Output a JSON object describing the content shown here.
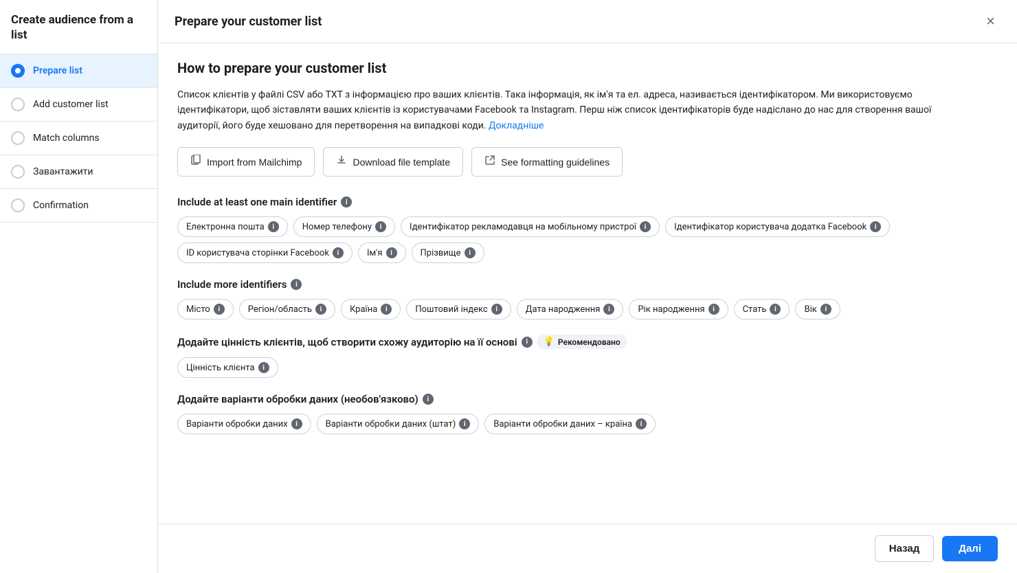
{
  "sidebar": {
    "title": "Create audience from a list",
    "items": [
      {
        "id": "prepare-list",
        "label": "Prepare list",
        "active": true
      },
      {
        "id": "add-customer-list",
        "label": "Add customer list",
        "active": false
      },
      {
        "id": "match-columns",
        "label": "Match columns",
        "active": false
      },
      {
        "id": "upload",
        "label": "Завантажити",
        "active": false
      },
      {
        "id": "confirmation",
        "label": "Confirmation",
        "active": false
      }
    ]
  },
  "header": {
    "title": "Prepare your customer list",
    "close_label": "×"
  },
  "main": {
    "section_title": "How to prepare your customer list",
    "description": "Список клієнтів у файлі CSV або TXT з інформацією про ваших клієнтів. Така інформація, як ім'я та ел. адреса, називається ідентифікатором. Ми використовуємо ідентифікатори, щоб зіставляти ваших клієнтів із користувачами Facebook та Instagram. Перш ніж список ідентифікаторів буде надіслано до нас для створення вашої аудиторії, його буде хешовано для перетворення на випадкові коди.",
    "description_link": "Докладніше",
    "action_buttons": [
      {
        "id": "import-mailchimp",
        "icon": "📋",
        "label": "Import from Mailchimp"
      },
      {
        "id": "download-template",
        "icon": "⬇",
        "label": "Download file template"
      },
      {
        "id": "formatting-guidelines",
        "icon": "🔗",
        "label": "See formatting guidelines"
      }
    ],
    "main_identifier_label": "Include at least one main identifier",
    "main_identifiers": [
      "Електронна пошта",
      "Номер телефону",
      "Ідентифікатор рекламодавця на мобільному пристрої",
      "Ідентифікатор користувача додатка Facebook",
      "ID користувача сторінки Facebook",
      "Ім'я",
      "Прізвище"
    ],
    "more_identifiers_label": "Include more identifiers",
    "more_identifiers": [
      "Місто",
      "Регіон/область",
      "Країна",
      "Поштовий індекс",
      "Дата народження",
      "Рік народження",
      "Стать",
      "Вік"
    ],
    "customer_value_label": "Додайте цінність клієнтів, щоб створити схожу аудиторію на її основі",
    "recommended_label": "Рекомендовано",
    "customer_value_tags": [
      "Цінність клієнта"
    ],
    "data_processing_label": "Додайте варіанти обробки даних (необов'язково)",
    "data_processing_tags": [
      "Варіанти обробки даних",
      "Варіанти обробки даних (штат)",
      "Варіанти обробки даних – країна"
    ],
    "footer": {
      "back_label": "Назад",
      "next_label": "Далі"
    }
  }
}
